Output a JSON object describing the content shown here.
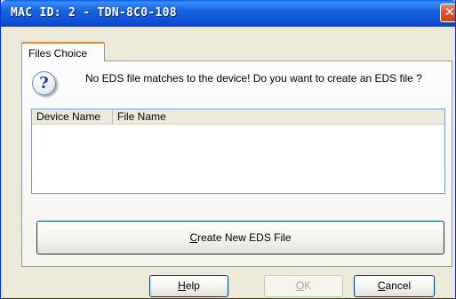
{
  "window": {
    "title": "MAC ID: 2 - TDN-8C0-108",
    "close_glyph": "✕"
  },
  "tabs": [
    {
      "label": "Files Choice",
      "selected": true
    }
  ],
  "message": {
    "icon": "question-icon",
    "icon_glyph": "?",
    "text": "No EDS file matches to the device! Do you want to create an EDS file ?"
  },
  "listview": {
    "columns": [
      "Device Name",
      "File Name"
    ],
    "rows": []
  },
  "buttons": {
    "create_mnemonic": "C",
    "create_rest": "reate New EDS File",
    "help_mnemonic": "H",
    "help_rest": "elp",
    "ok_mnemonic": "O",
    "ok_rest": "K",
    "ok_enabled": false,
    "cancel_mnemonic": "C",
    "cancel_rest": "ancel"
  },
  "colors": {
    "titlebar": "#0a5ee8",
    "close": "#e05a30",
    "tab_accent": "#e68b2c",
    "window_bg": "#ece9d8"
  }
}
